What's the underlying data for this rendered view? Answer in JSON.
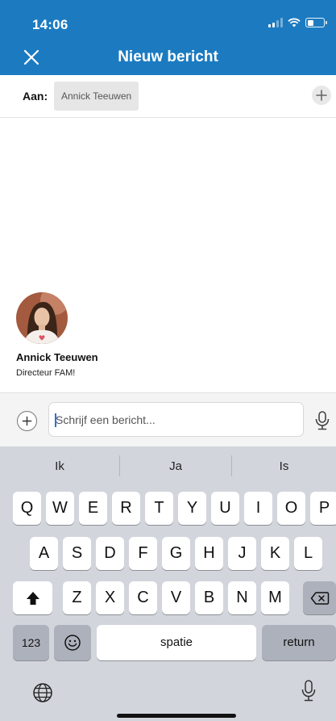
{
  "status_bar": {
    "time": "14:06",
    "battery_level": 0.4
  },
  "nav": {
    "title": "Nieuw bericht"
  },
  "to_row": {
    "label": "Aan:",
    "recipient": "Annick Teeuwen"
  },
  "contact": {
    "name": "Annick Teeuwen",
    "title": "Directeur FAM!"
  },
  "compose": {
    "placeholder": "Schrijf een bericht..."
  },
  "keyboard": {
    "suggestions": [
      "Ik",
      "Ja",
      "Is"
    ],
    "row1": [
      "Q",
      "W",
      "E",
      "R",
      "T",
      "Y",
      "U",
      "I",
      "O",
      "P"
    ],
    "row2": [
      "A",
      "S",
      "D",
      "F",
      "G",
      "H",
      "J",
      "K",
      "L"
    ],
    "row3": [
      "Z",
      "X",
      "C",
      "V",
      "B",
      "N",
      "M"
    ],
    "numbers_label": "123",
    "space_label": "spatie",
    "return_label": "return"
  },
  "colors": {
    "brand": "#1c7bc0",
    "keyboard_bg": "#d2d5dc",
    "caret": "#2e6fe0"
  }
}
